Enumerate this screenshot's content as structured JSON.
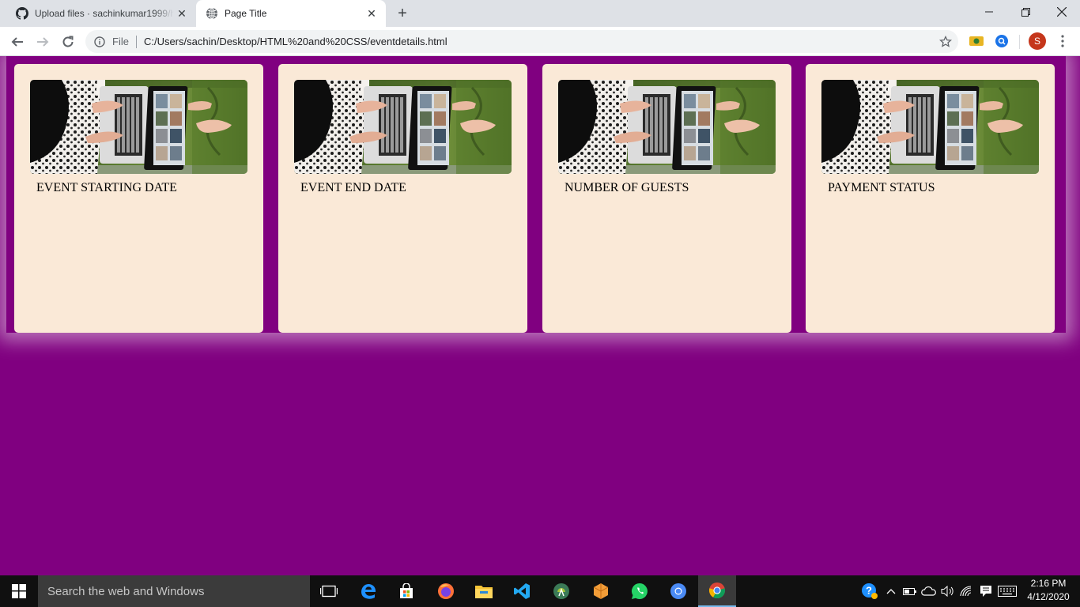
{
  "browser": {
    "tabs": [
      {
        "title": "Upload files · sachinkumar1999/ht",
        "icon": "github-icon",
        "active": false
      },
      {
        "title": "Page Title",
        "icon": "globe-icon",
        "active": true
      }
    ],
    "address": {
      "scheme_label": "File",
      "url": "C:/Users/sachin/Desktop/HTML%20and%20CSS/eventdetails.html"
    },
    "profile_initial": "S"
  },
  "page": {
    "background_color": "#800080",
    "card_color": "#fae9d7",
    "cards": [
      {
        "label": "EVENT STARTING DATE",
        "image": "woman-with-laptop-photo"
      },
      {
        "label": "EVENT END DATE",
        "image": "woman-with-laptop-photo"
      },
      {
        "label": "NUMBER OF GUESTS",
        "image": "woman-with-laptop-photo"
      },
      {
        "label": "PAYMENT STATUS",
        "image": "woman-with-laptop-photo"
      }
    ]
  },
  "taskbar": {
    "search_placeholder": "Search the web and Windows",
    "apps": [
      "task-view-icon",
      "edge-icon",
      "store-icon",
      "firefox-icon",
      "file-explorer-icon",
      "vscode-icon",
      "android-studio-icon",
      "package-icon",
      "whatsapp-icon",
      "chromium-icon",
      "chrome-icon"
    ],
    "time": "2:16 PM",
    "date": "4/12/2020"
  }
}
